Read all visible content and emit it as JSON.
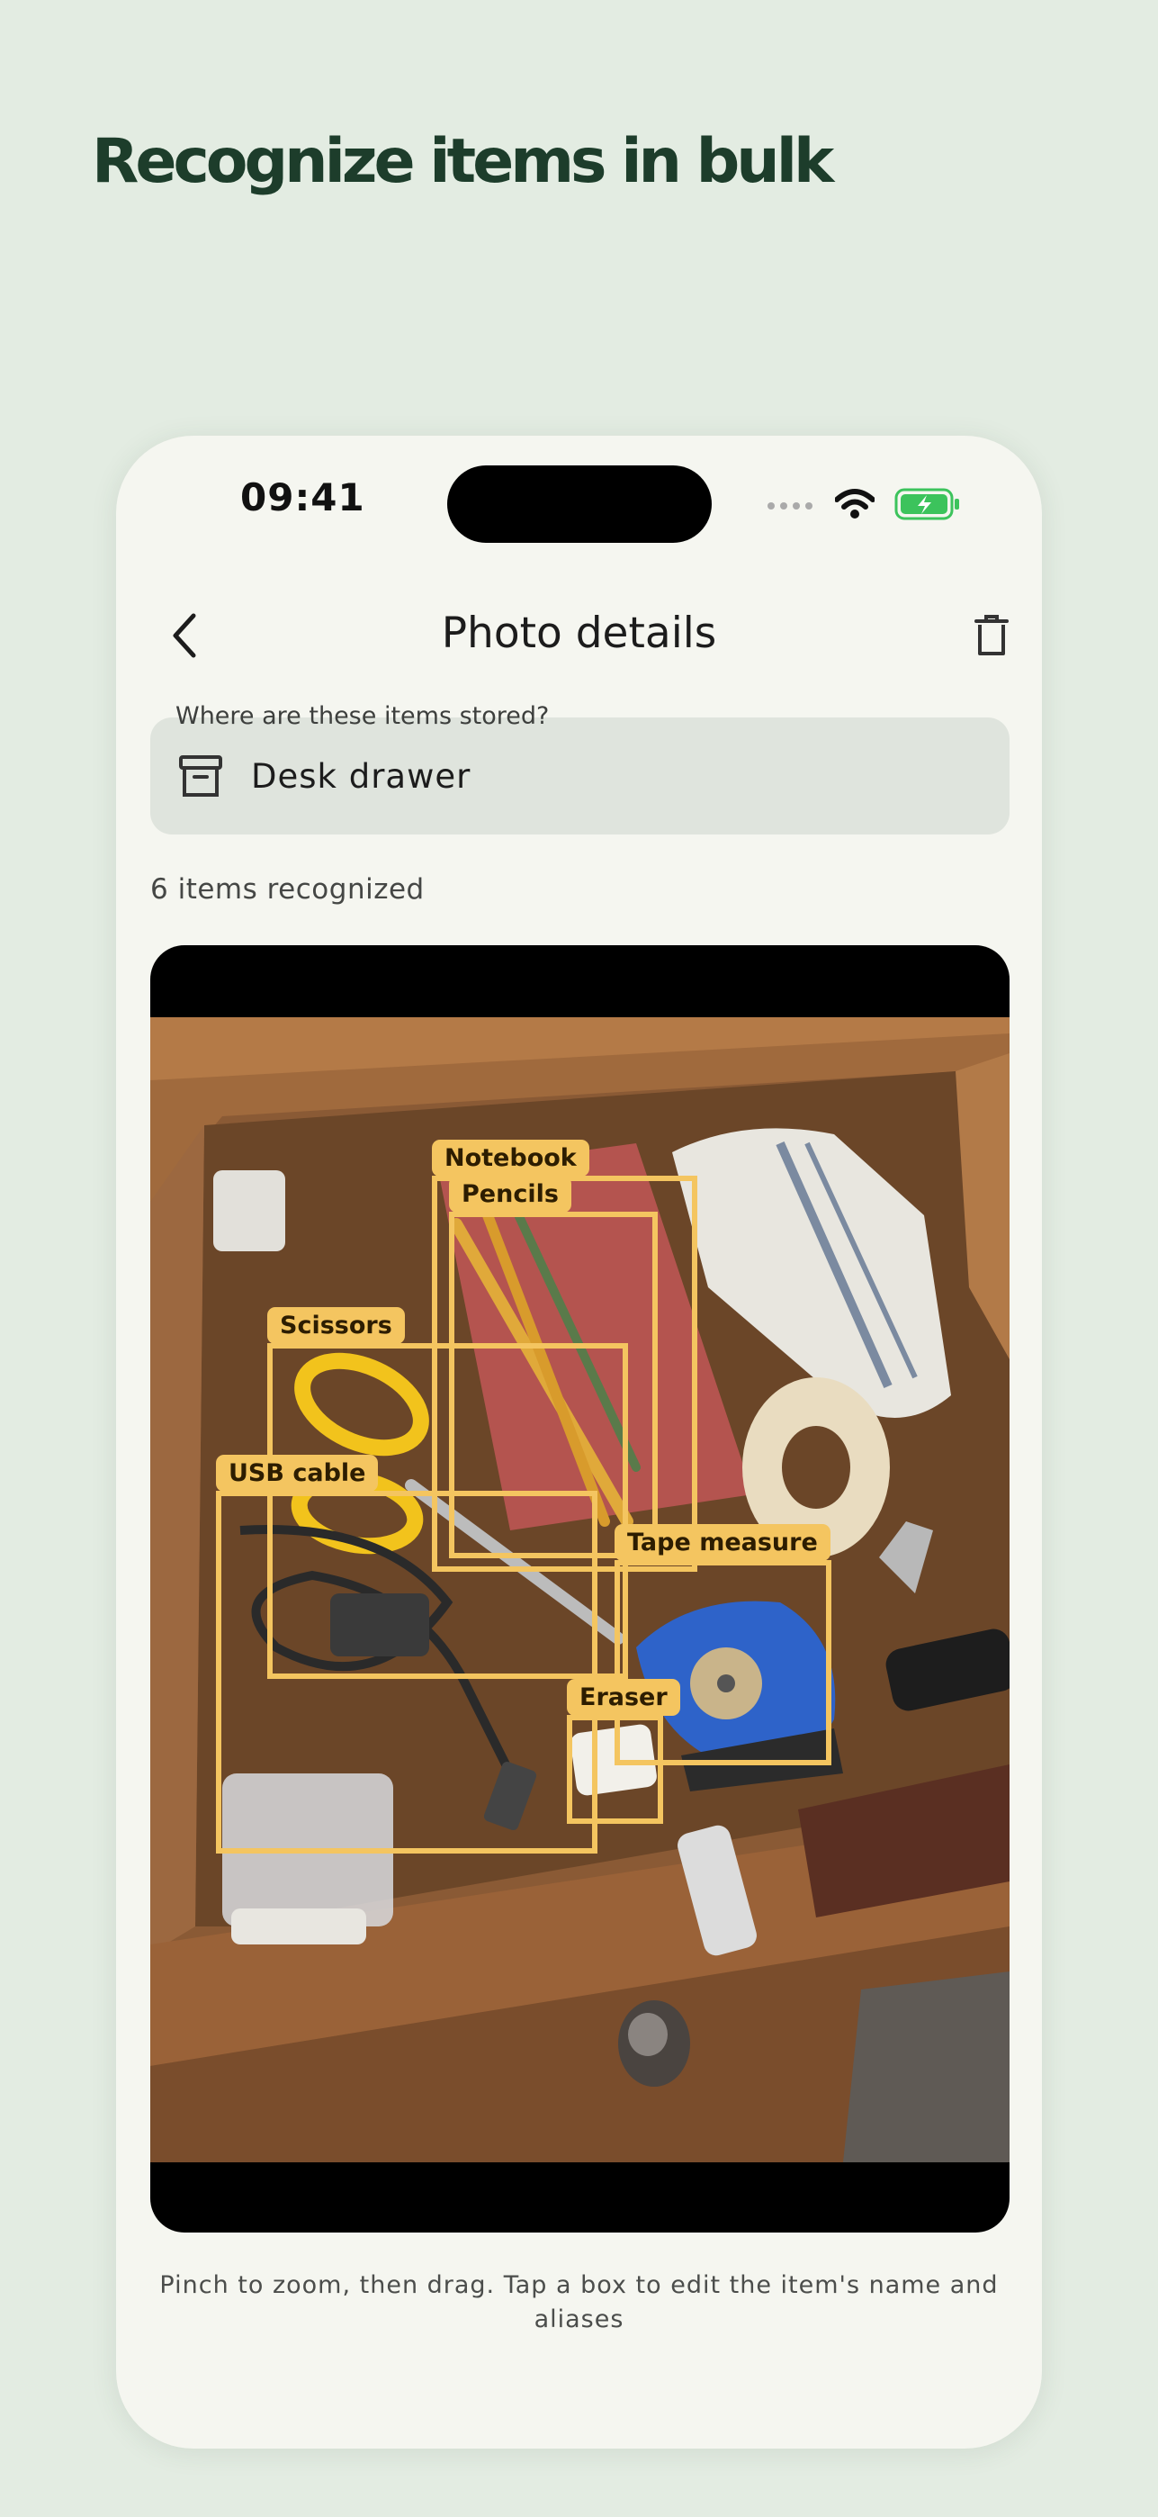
{
  "page": {
    "headline": "Recognize items in bulk"
  },
  "status_bar": {
    "time": "09:41",
    "icons": [
      "signal-dots-icon",
      "wifi-icon",
      "battery-charging-icon"
    ],
    "battery_color": "#3cc35c"
  },
  "nav": {
    "back_icon": "chevron-left-icon",
    "title": "Photo details",
    "trash_icon": "trash-icon"
  },
  "location": {
    "label": "Where are these items stored?",
    "value": "Desk drawer",
    "icon": "archive-box-icon"
  },
  "recognized_count": "6 items recognized",
  "boxes": [
    {
      "name": "box-notebook",
      "label": "Notebook"
    },
    {
      "name": "box-pencils",
      "label": "Pencils"
    },
    {
      "name": "box-scissors",
      "label": "Scissors"
    },
    {
      "name": "box-usb-cable",
      "label": "USB cable"
    },
    {
      "name": "box-tape-measure",
      "label": "Tape measure"
    },
    {
      "name": "box-eraser",
      "label": "Eraser"
    }
  ],
  "box_color": "#f4c560",
  "hint": "Pinch to zoom, then drag. Tap a box to edit the item's name and aliases"
}
